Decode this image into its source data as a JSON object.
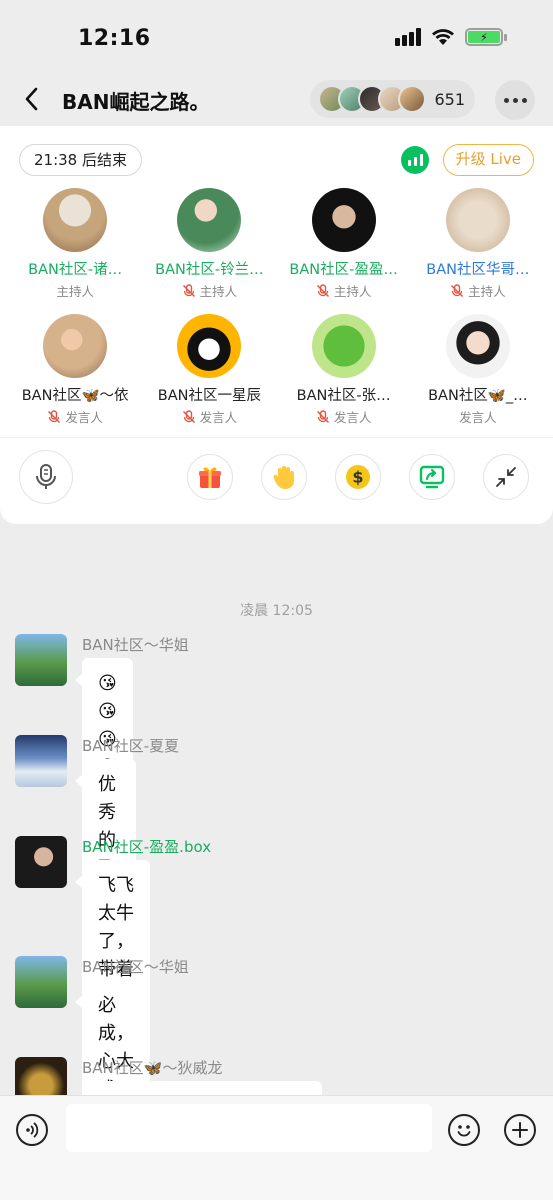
{
  "status_bar": {
    "time": "12:16"
  },
  "header": {
    "title": "BAN崛起之路。",
    "audience_count": "651"
  },
  "live": {
    "timer": "21:38 后结束",
    "upgrade_label": "升级 Live",
    "speakers": [
      {
        "name": "BAN社区-诸…",
        "role": "主持人",
        "muted": false,
        "color": "green"
      },
      {
        "name": "BAN社区-铃兰…",
        "role": "主持人",
        "muted": true,
        "color": "green"
      },
      {
        "name": "BAN社区-盈盈…",
        "role": "主持人",
        "muted": true,
        "color": "green"
      },
      {
        "name": "BAN社区华哥…",
        "role": "主持人",
        "muted": true,
        "color": "blue"
      },
      {
        "name": "BAN社区🦋～依",
        "role": "发言人",
        "muted": true,
        "color": "dark"
      },
      {
        "name": "BAN社区一星辰",
        "role": "发言人",
        "muted": true,
        "color": "dark"
      },
      {
        "name": "BAN社区-张…",
        "role": "发言人",
        "muted": true,
        "color": "dark"
      },
      {
        "name": "BAN社区🦋_…",
        "role": "发言人",
        "muted": false,
        "color": "dark"
      }
    ]
  },
  "chat": {
    "timestamp": "凌晨 12:05",
    "messages": [
      {
        "sender": "BAN社区～华姐",
        "text": "😘😘😘😘😘😘😘"
      },
      {
        "sender": "BAN社区-夏夏",
        "text": "优秀的飞飞👍👍👍"
      },
      {
        "sender": "BAN社区-盈盈.box",
        "text_line1": "飞飞太牛了，带着曾经的老板一起飞",
        "text_line2": "😘😘😘😘"
      },
      {
        "sender": "BAN社区～华姐",
        "text": "必成，心大成"
      },
      {
        "sender": "BAN社区🦋～狄威龙",
        "text": ""
      }
    ]
  },
  "colors": {
    "accent_green": "#07c160",
    "upgrade_orange": "#e3a22c",
    "name_blue": "#2e7bd6"
  }
}
